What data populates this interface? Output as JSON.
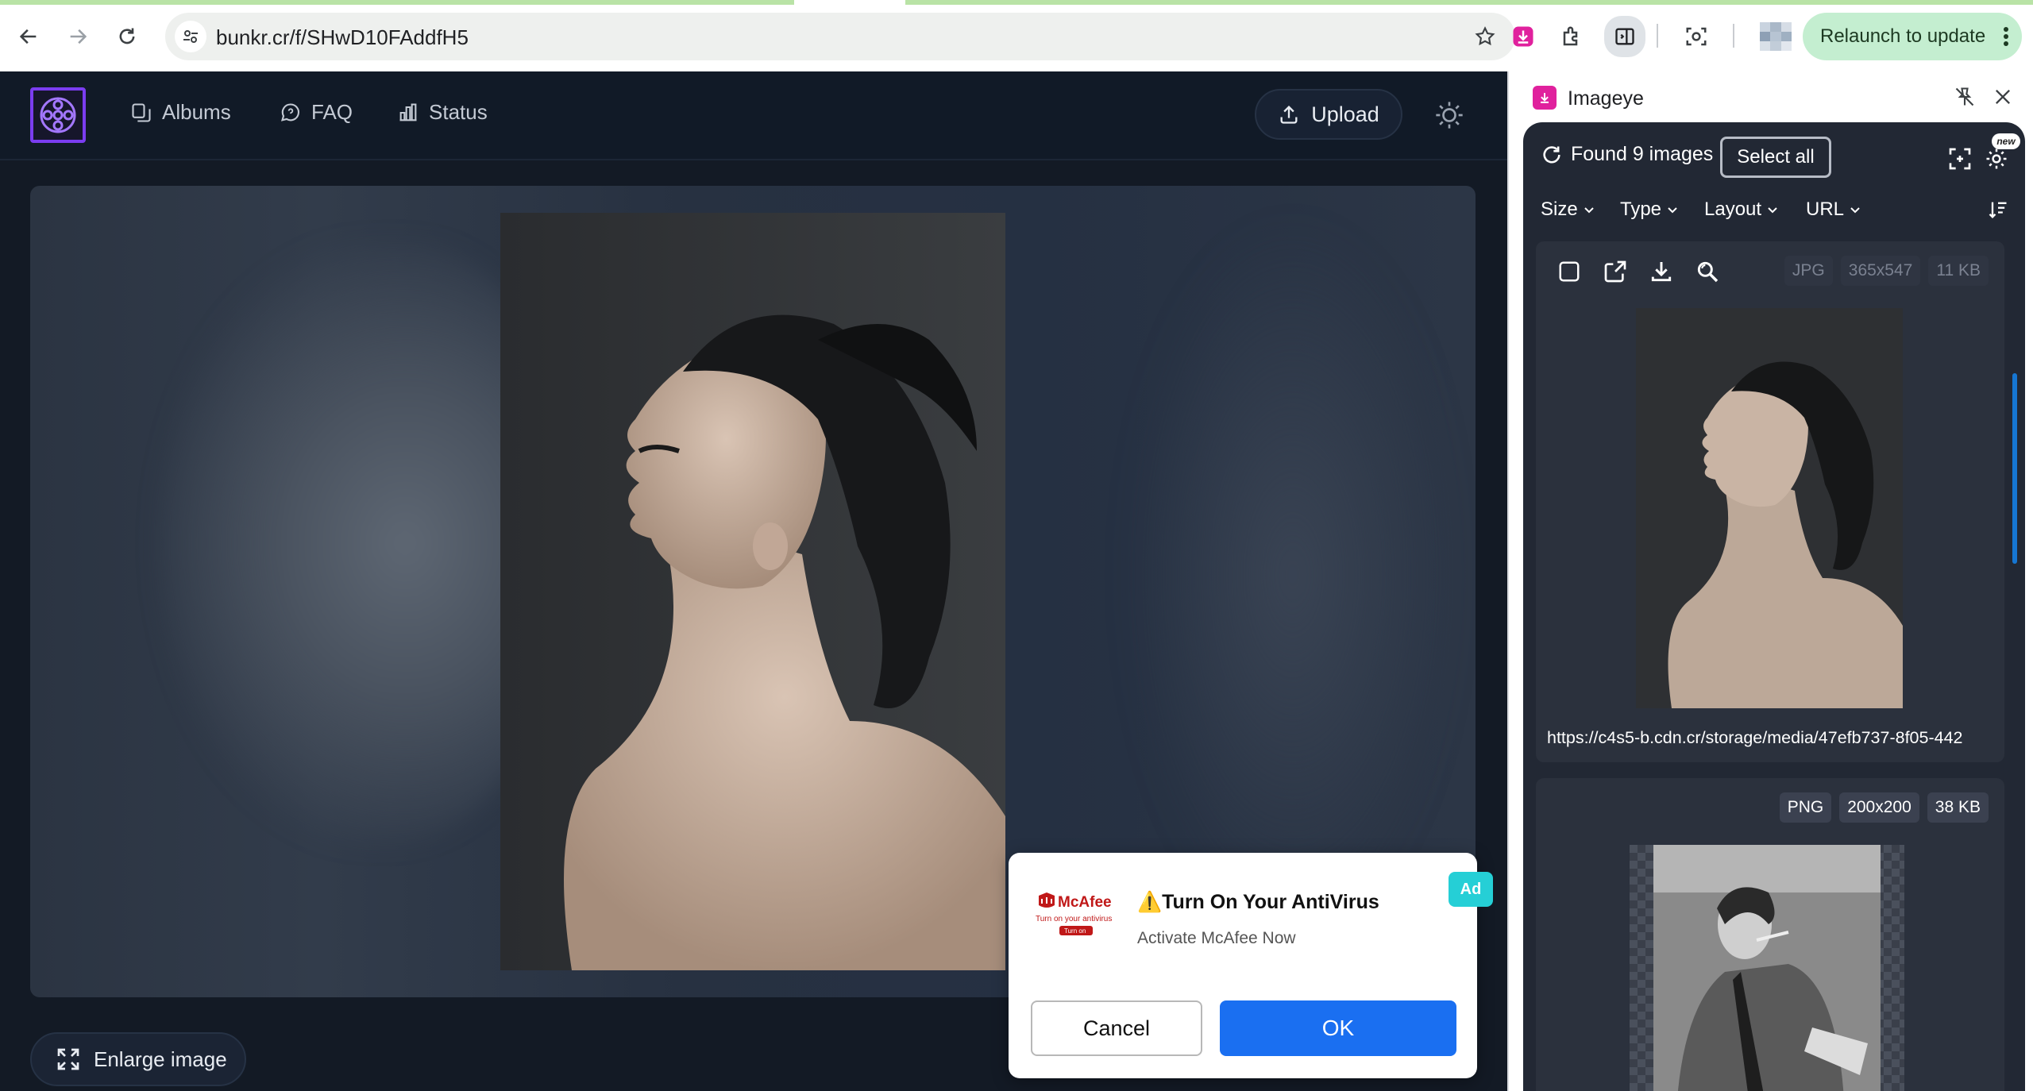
{
  "browser": {
    "url": "bunkr.cr/f/SHwD10FAddfH5",
    "relaunch_label": "Relaunch to update"
  },
  "site": {
    "nav": [
      {
        "label": "Albums",
        "icon": "albums-icon"
      },
      {
        "label": "FAQ",
        "icon": "faq-icon"
      },
      {
        "label": "Status",
        "icon": "status-icon"
      }
    ],
    "upload_label": "Upload",
    "enlarge_label": "Enlarge image"
  },
  "ad": {
    "brand": "McAfee",
    "brand_tag": "Turn on your antivirus",
    "brand_btn": "Turn on",
    "title": "⚠️Turn On Your AntiVirus",
    "subtitle": "Activate McAfee Now",
    "badge": "Ad",
    "cancel_label": "Cancel",
    "ok_label": "OK"
  },
  "panel": {
    "title": "Imageye",
    "found_label": "Found 9 images",
    "select_all_label": "Select all",
    "new_badge": "new",
    "filters": [
      "Size",
      "Type",
      "Layout",
      "URL"
    ],
    "images": [
      {
        "format": "JPG",
        "dimensions": "365x547",
        "size": "11 KB",
        "url": "https://c4s5-b.cdn.cr/storage/media/47efb737-8f05-442"
      },
      {
        "format": "PNG",
        "dimensions": "200x200",
        "size": "38 KB"
      }
    ]
  },
  "colors": {
    "site_bg": "#131a25",
    "logo_accent": "#7b3df0",
    "ok_button": "#1a6ff1",
    "ad_badge": "#25cfd6",
    "relaunch_bg": "#c4eed0",
    "imageye_brand": "#e0219d"
  }
}
